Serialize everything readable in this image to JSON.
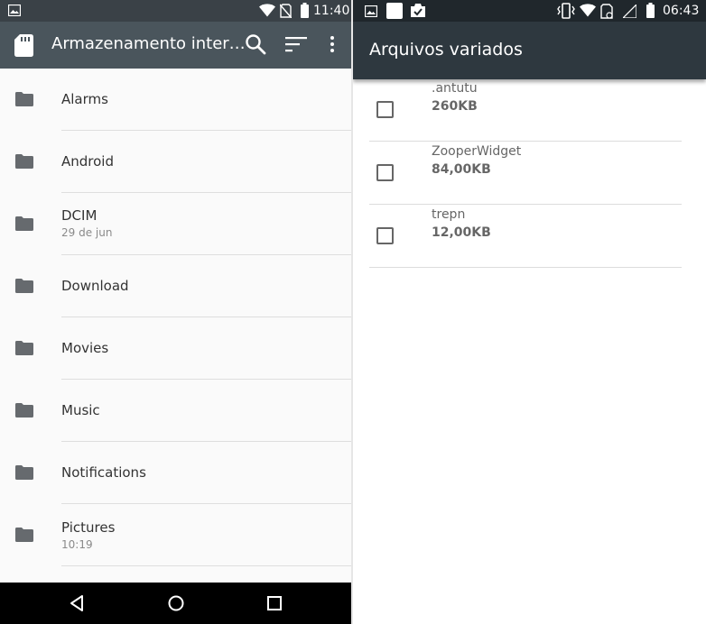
{
  "left": {
    "status_time": "11:40",
    "title": "Armazenamento inter…",
    "folders": [
      {
        "name": "Alarms",
        "sub": ""
      },
      {
        "name": "Android",
        "sub": ""
      },
      {
        "name": "DCIM",
        "sub": "29 de jun"
      },
      {
        "name": "Download",
        "sub": ""
      },
      {
        "name": "Movies",
        "sub": ""
      },
      {
        "name": "Music",
        "sub": ""
      },
      {
        "name": "Notifications",
        "sub": ""
      },
      {
        "name": "Pictures",
        "sub": "10:19"
      }
    ]
  },
  "right": {
    "status_time": "06:43",
    "title": "Arquivos variados",
    "files": [
      {
        "name": ".antutu",
        "size": "260KB"
      },
      {
        "name": "ZooperWidget",
        "size": "84,00KB"
      },
      {
        "name": "trepn",
        "size": "12,00KB"
      }
    ]
  },
  "colors": {
    "left_toolbar": "#4a555c",
    "right_toolbar": "#2e383f",
    "folder_icon": "#666a6e"
  },
  "icons": {
    "left_status": [
      "image-icon",
      "wifi-icon",
      "no-sim-icon",
      "battery-icon"
    ],
    "left_toolbar": [
      "sd-card-icon",
      "search-icon",
      "sort-icon",
      "more-vert-icon"
    ],
    "nav": [
      "back-icon",
      "home-icon",
      "recents-icon"
    ],
    "right_status": [
      "image-icon",
      "blank-notification-icon",
      "clipboard-check-icon",
      "vibrate-icon",
      "wifi-icon",
      "no-sim-icon",
      "signal-icon",
      "battery-icon"
    ]
  }
}
